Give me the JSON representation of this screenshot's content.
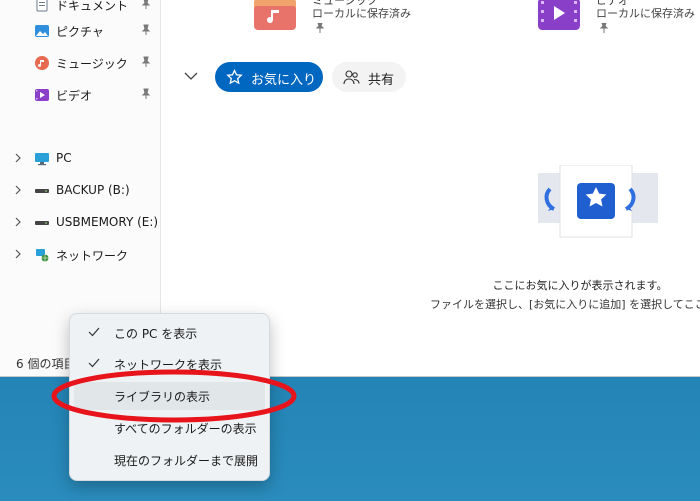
{
  "sidebar": {
    "quick_access": [
      {
        "label": "ドキュメント",
        "icon": "documents-icon"
      },
      {
        "label": "ピクチャ",
        "icon": "pictures-icon"
      },
      {
        "label": "ミュージック",
        "icon": "music-icon"
      },
      {
        "label": "ビデオ",
        "icon": "videos-icon"
      }
    ],
    "drives": [
      {
        "label": "PC",
        "icon": "pc-icon"
      },
      {
        "label": "BACKUP (B:)",
        "icon": "drive-icon"
      },
      {
        "label": "USBMEMORY (E:)",
        "icon": "usb-drive-icon"
      },
      {
        "label": "ネットワーク",
        "icon": "network-icon"
      }
    ]
  },
  "status": {
    "item_count": "6 個の項目"
  },
  "files": [
    {
      "name": "ミュージック",
      "location": "ローカルに保存済み",
      "icon": "music-folder-icon"
    },
    {
      "name": "ビデオ",
      "location": "ローカルに保存済み",
      "icon": "video-folder-icon"
    }
  ],
  "tabs": {
    "favorites": "お気に入り",
    "shared": "共有"
  },
  "empty_state": {
    "title": "ここにお気に入りが表示されます。",
    "description": "ファイルを選択し、[お気に入りに追加] を選択してここにアク"
  },
  "context_menu": {
    "items": [
      {
        "label": "この PC を表示",
        "checked": true
      },
      {
        "label": "ネットワークを表示",
        "checked": true
      },
      {
        "label": "ライブラリの表示",
        "checked": false,
        "highlighted": true
      },
      {
        "label": "すべてのフォルダーの表示",
        "checked": false
      },
      {
        "label": "現在のフォルダーまで展開",
        "checked": false
      }
    ]
  },
  "colors": {
    "accent": "#0067c0",
    "annotation": "#e8141b"
  }
}
